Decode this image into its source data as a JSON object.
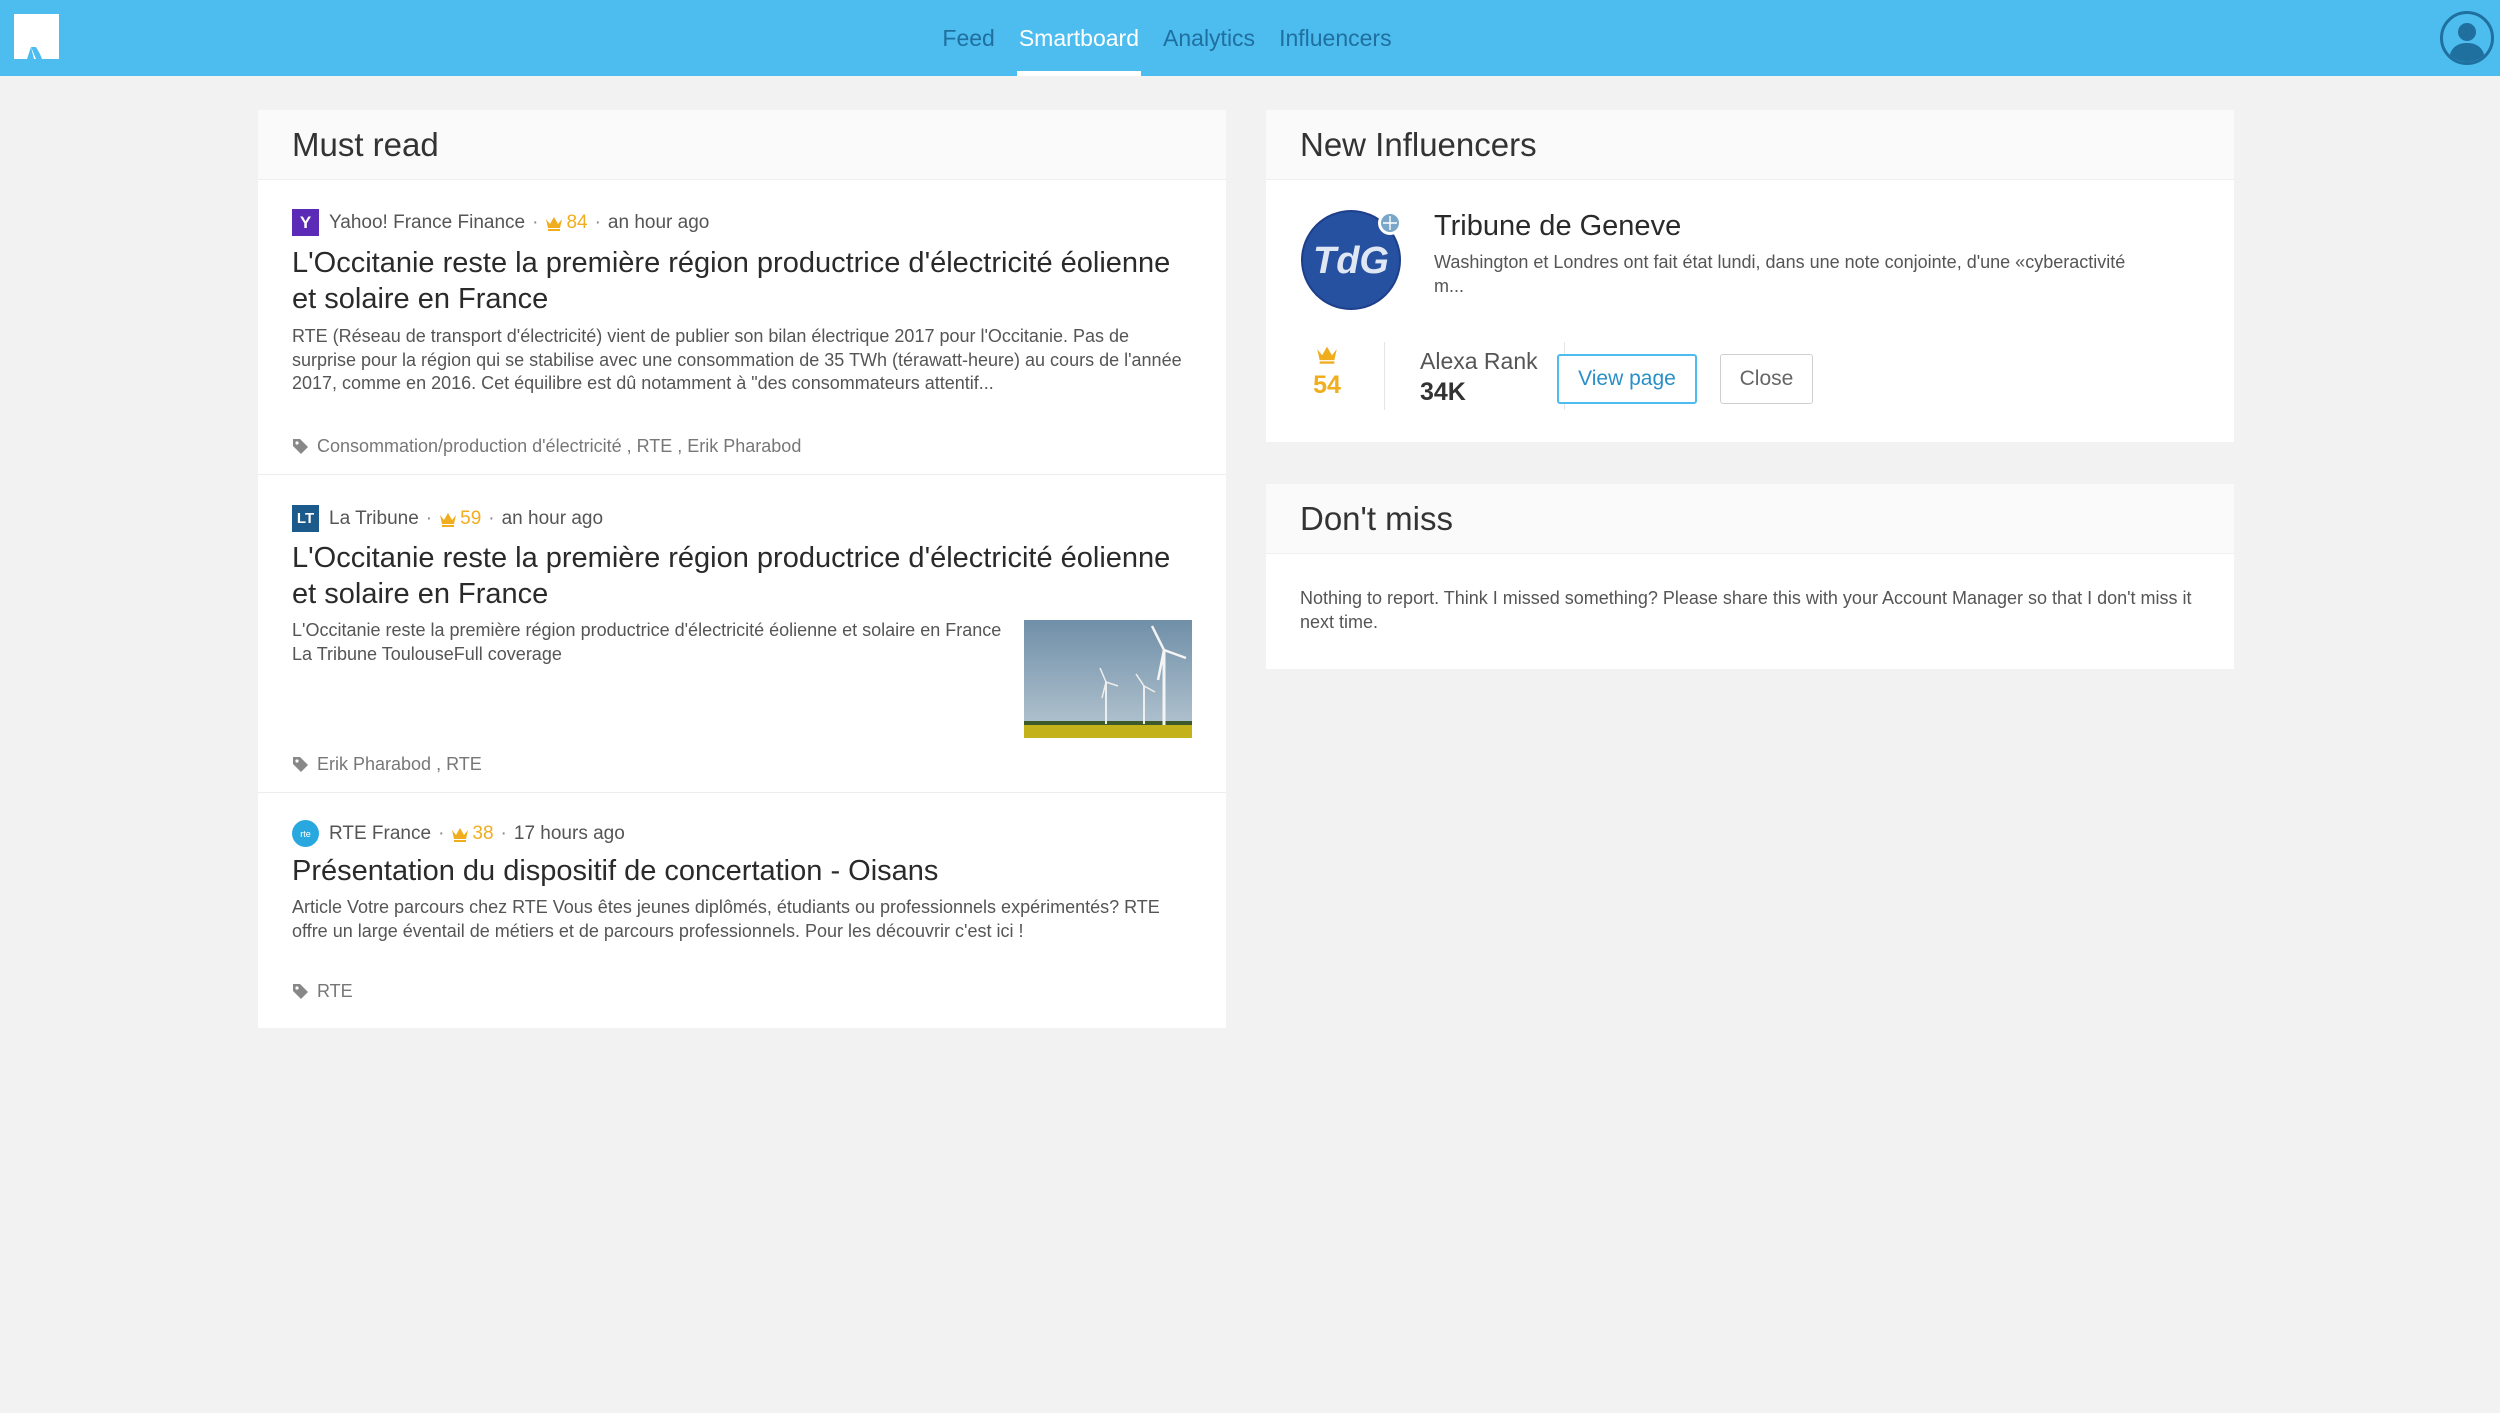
{
  "nav": {
    "items": [
      {
        "label": "Feed",
        "active": false
      },
      {
        "label": "Smartboard",
        "active": true
      },
      {
        "label": "Analytics",
        "active": false
      },
      {
        "label": "Influencers",
        "active": false
      }
    ]
  },
  "must_read": {
    "title": "Must read",
    "articles": [
      {
        "source": "Yahoo! France Finance",
        "source_icon": "Y",
        "source_color": "#5b2bb8",
        "score": "84",
        "time": "an hour ago",
        "title": "L'Occitanie reste la première région productrice d'électricité éolienne et solaire en France",
        "summary": "RTE (Réseau de transport d'électricité) vient de publier son bilan électrique 2017 pour l'Occitanie. Pas de surprise pour la région qui se stabilise avec une consommation de 35 TWh (térawatt-heure) au cours de l'année 2017, comme en 2016. Cet équilibre est dû notamment à \"des consommateurs attentif...",
        "tags": "Consommation/production d'électricité , RTE , Erik Pharabod"
      },
      {
        "source": "La Tribune",
        "source_icon": "LT",
        "source_color": "#1b5a8a",
        "score": "59",
        "time": "an hour ago",
        "title": "L'Occitanie reste la première région productrice d'électricité éolienne et solaire en France",
        "summary": "L'Occitanie reste la première région productrice d'électricité éolienne et solaire en France  La Tribune ToulouseFull coverage",
        "tags": "Erik Pharabod , RTE"
      },
      {
        "source": "RTE France",
        "source_icon": "rte",
        "source_color": "#29a8e0",
        "score": "38",
        "time": "17 hours ago",
        "title": "Présentation du dispositif de concertation - Oisans",
        "summary": "Article Votre parcours chez RTE Vous êtes jeunes diplômés, étudiants ou professionnels expérimentés? RTE offre un large éventail de métiers et de parcours professionnels. Pour les découvrir c'est ici !",
        "tags": "RTE"
      }
    ]
  },
  "new_influencers": {
    "title": "New Influencers",
    "name": "Tribune de Geneve",
    "logo_text": "TdG",
    "description": "Washington et Londres ont fait état lundi, dans une note conjointe, d'une «cyberactivité m...",
    "score": "54",
    "alexa_label": "Alexa Rank",
    "alexa_value": "34K",
    "view_label": "View page",
    "close_label": "Close"
  },
  "dont_miss": {
    "title": "Don't miss",
    "text": "Nothing to report. Think I missed something? Please share this with your Account Manager so that I don't miss it next time."
  },
  "colors": {
    "topbar": "#4dbdf0",
    "accent": "#f0ad1e",
    "link": "#2a8fc7"
  }
}
